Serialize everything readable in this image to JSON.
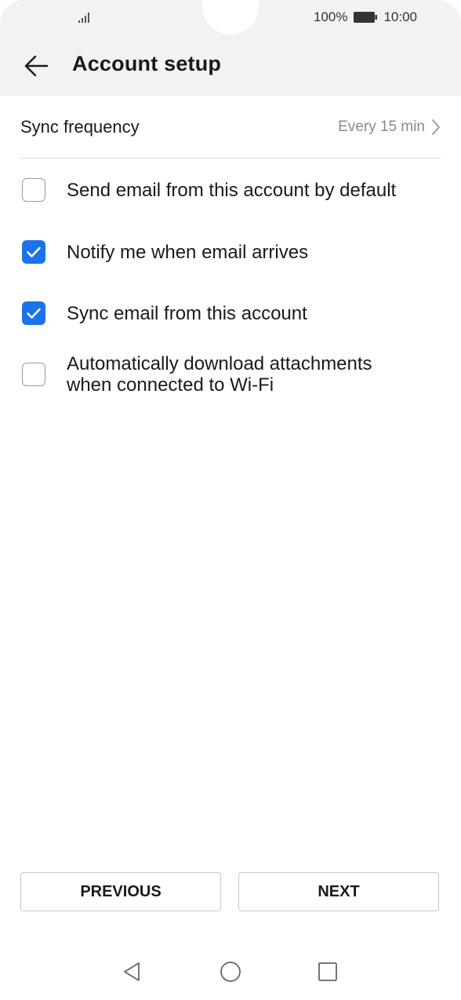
{
  "status_bar": {
    "battery_percent": "100%",
    "time": "10:00"
  },
  "header": {
    "title": "Account setup"
  },
  "sync": {
    "label": "Sync frequency",
    "value": "Every 15 min"
  },
  "options": [
    {
      "label": "Send email from this account by default",
      "checked": false
    },
    {
      "label": "Notify me when email arrives",
      "checked": true
    },
    {
      "label": "Sync email from this account",
      "checked": true
    },
    {
      "label": "Automatically download attachments when connected to Wi-Fi",
      "checked": false
    }
  ],
  "buttons": {
    "previous": "PREVIOUS",
    "next": "NEXT"
  },
  "colors": {
    "accent": "#1a73e8",
    "header_bg": "#f2f2f2"
  },
  "icons": {
    "back": "arrow-left-icon",
    "chevron": "chevron-right-icon",
    "nav_back": "triangle-back-icon",
    "nav_home": "circle-home-icon",
    "nav_recents": "square-recents-icon"
  }
}
